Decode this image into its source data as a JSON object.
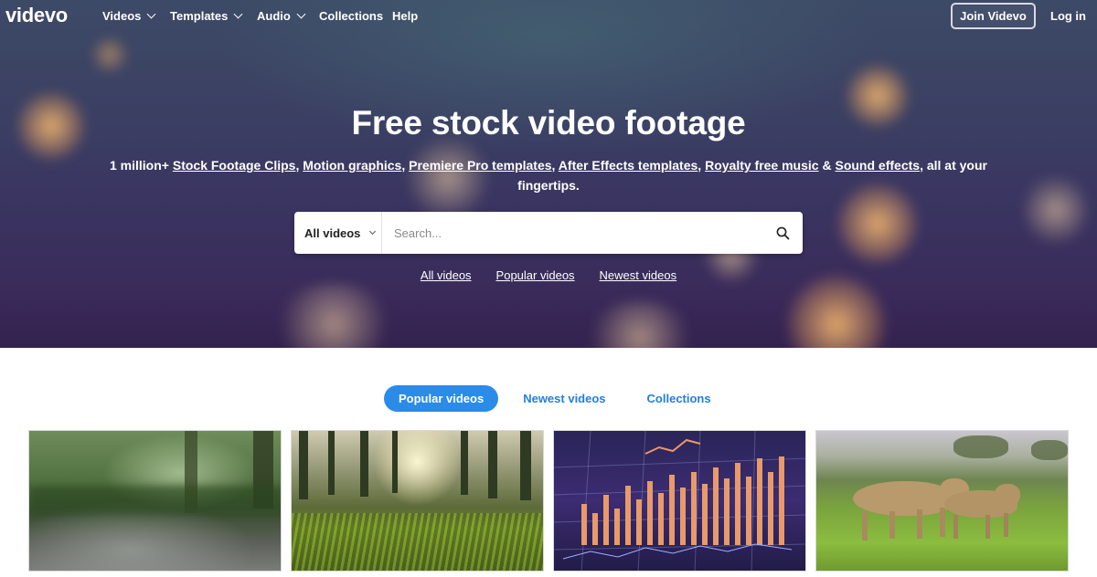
{
  "nav": {
    "logo": "videvo",
    "items": [
      {
        "label": "Videos",
        "dropdown": true
      },
      {
        "label": "Templates",
        "dropdown": true
      },
      {
        "label": "Audio",
        "dropdown": true
      },
      {
        "label": "Collections",
        "dropdown": false
      },
      {
        "label": "Help",
        "dropdown": false
      }
    ],
    "join_label": "Join Videvo",
    "login_label": "Log in"
  },
  "hero": {
    "title": "Free stock video footage",
    "subtitle_prefix": "1 million+",
    "links": [
      "Stock Footage Clips",
      "Motion graphics",
      "Premiere Pro templates",
      "After Effects templates",
      "Royalty free music",
      "Sound effects"
    ],
    "subtitle_and": "&",
    "subtitle_suffix": ", all at your fingertips."
  },
  "search": {
    "type_label": "All videos",
    "placeholder": "Search...",
    "icon": "search-icon"
  },
  "quick_links": [
    "All videos",
    "Popular videos",
    "Newest videos"
  ],
  "tabs": {
    "active": "Popular videos",
    "others": [
      "Newest videos",
      "Collections"
    ]
  },
  "colors": {
    "accent": "#2b8be8",
    "hero_top": "#3d4a66",
    "hero_bottom": "#33224f"
  }
}
